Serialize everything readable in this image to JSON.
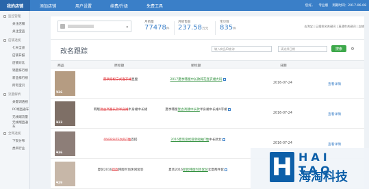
{
  "topbar": {
    "brand": "我的店铺",
    "nav": [
      "添加店铺",
      "用户设置",
      "续费/升级",
      "免费工具"
    ],
    "greeting": "您好，",
    "version": "专业版",
    "expiry": "到期时间：2017-06-08"
  },
  "sidebar": {
    "groups": [
      {
        "label": "监控管理",
        "items": [
          "关注店铺",
          "关注宝品"
        ]
      },
      {
        "label": "店铺透视",
        "items": [
          "七天全览",
          "店铺日报",
          "店铺对比",
          "销量排行榜",
          "新品排行榜",
          "所有宝贝"
        ]
      },
      {
        "label": "流量解析",
        "items": [
          "关键词透视",
          "PC端直通车",
          "无线端流量",
          "无线端直通车"
        ]
      },
      {
        "label": "全网透视",
        "items": [
          "下架分布",
          "类目行业"
        ]
      }
    ]
  },
  "header": {
    "stats": [
      {
        "label": "月销量",
        "value": "77478",
        "unit": "件"
      },
      {
        "label": "月销售额",
        "value": "237.58",
        "unit": "万元"
      },
      {
        "label": "宝贝数",
        "value": "835",
        "unit": "件"
      }
    ],
    "links": "去淘宝 | 日搜排名关键词 | 直通车关键词 | 店铺"
  },
  "page": {
    "title": "改名跟踪",
    "search_placeholder": "输入商品ID查询",
    "date_placeholder": "请选择日期",
    "search_button": "搜索",
    "settings_glyph": "⚙"
  },
  "table": {
    "headers": [
      "商品",
      "原标题",
      "新标题",
      "日期",
      ""
    ],
    "rows": [
      {
        "price": "¥26",
        "thumb_color": "#b59c82",
        "old_prefix": "",
        "old_red": "夏款宽松宁式连衣裙",
        "old_suffix": "显瘦",
        "new_prefix": "",
        "new_green": "2017夏季韩版中长款碎花连衣裙大码",
        "new_suffix": "",
        "date": "2016-07-24",
        "detail": "查看详情"
      },
      {
        "price": "¥33",
        "thumb_color": "#7e6f66",
        "old_prefix": "韩版",
        "old_red": "复古高腰长款半身裙",
        "old_suffix": "半身裙中长裙",
        "new_prefix": "夏季韩版",
        "new_green": "复古高腰中长款",
        "new_suffix": "半身裙中长裙A字裙",
        "date": "2016-07-24",
        "detail": "查看详情"
      },
      {
        "price": "¥36",
        "thumb_color": "#8d7e78",
        "old_prefix": "",
        "old_red": "OVERSIZE大码T恤",
        "old_suffix": "百搭",
        "new_prefix": "",
        "new_green": "2016夏装宽松圆领短袖T恤",
        "new_suffix": "中长款女",
        "date": "2016-07-24",
        "detail": "查看详情"
      },
      {
        "price": "¥29",
        "thumb_color": "#c7b7a8",
        "old_prefix": "夏装2016",
        "old_red": "新款",
        "old_suffix": "韩版时尚休闲套装",
        "new_prefix": "夏装2016",
        "new_green": "新款韩版时尚套装",
        "new_suffix": "女夏两件套",
        "date": "2016-07-24",
        "detail": "查看详情"
      }
    ]
  },
  "watermark": {
    "logo": "H",
    "en": "HAI TAO",
    "cn": "海淘科技"
  }
}
